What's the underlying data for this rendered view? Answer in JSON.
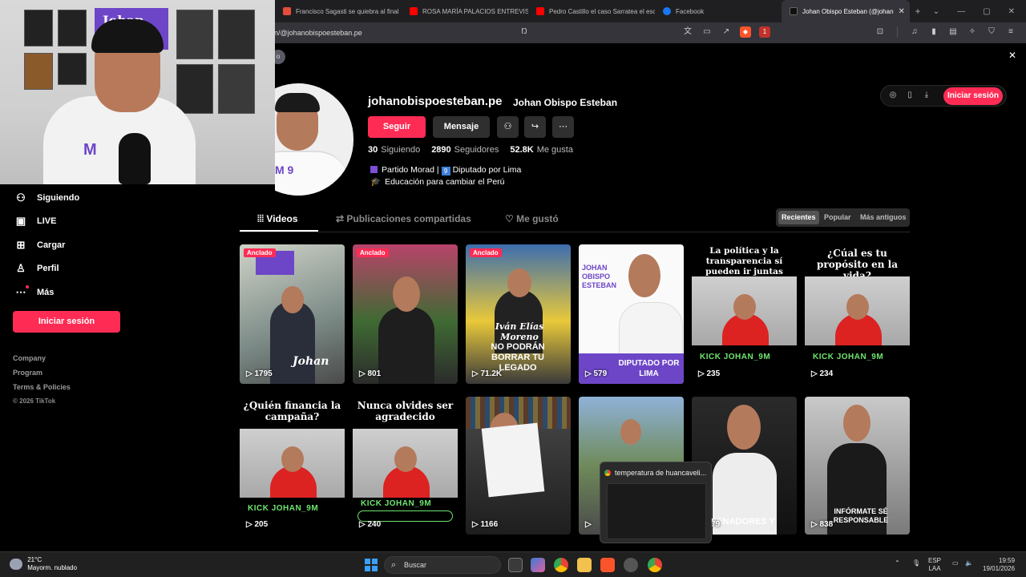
{
  "browser": {
    "tabs": [
      {
        "title": "Francisco Sagasti se quiebra al final",
        "color": "#e74c3c"
      },
      {
        "title": "ROSA MARÍA PALACIOS ENTREVISTA",
        "color": "#ff0000"
      },
      {
        "title": "Pedro Castillo el caso Sarratea el esc",
        "color": "#ff0000"
      },
      {
        "title": "Facebook",
        "color": "#1877f2"
      },
      {
        "title": "Johan Obispo Esteban (@johan",
        "color": "#111111"
      }
    ],
    "url": "n/@johanobispoesteban.pe",
    "brave_badge": "1"
  },
  "sidebar": {
    "items": [
      {
        "icon": "following-icon",
        "glyph": "⚇",
        "label": "Siguiendo"
      },
      {
        "icon": "live-icon",
        "glyph": "▣",
        "label": "LIVE"
      },
      {
        "icon": "upload-icon",
        "glyph": "⊞",
        "label": "Cargar"
      },
      {
        "icon": "profile-icon",
        "glyph": "♙",
        "label": "Perfil"
      },
      {
        "icon": "more-icon",
        "glyph": "⋯",
        "label": "Más"
      }
    ],
    "login_label": "Iniciar sesión",
    "footer": [
      "Company",
      "Program",
      "Terms & Policies",
      "© 2026 TikTok"
    ]
  },
  "profile": {
    "username": "johanobispoesteban.pe",
    "nickname": "Johan Obispo Esteban",
    "follow_label": "Seguir",
    "message_label": "Mensaje",
    "stats": {
      "following_count": "30",
      "following_label": "Siguiendo",
      "followers_count": "2890",
      "followers_label": "Seguidores",
      "likes_count": "52.8K",
      "likes_label": "Me gusta"
    },
    "bio_line1a": "Partido Morad |",
    "bio_line1b": "Diputado por Lima",
    "bio_line2": "Educación para cambiar el Perú",
    "bio_nine": "9"
  },
  "header": {
    "login_label": "Iniciar sesión"
  },
  "tabs": {
    "videos": "Videos",
    "shared": "Publicaciones compartidas",
    "liked": "Me gustó",
    "sort": [
      "Recientes",
      "Popular",
      "Más antiguos"
    ]
  },
  "videos": [
    {
      "views": "1795",
      "pinned": "Anclado",
      "caption": "Johan"
    },
    {
      "views": "801",
      "pinned": "Anclado"
    },
    {
      "views": "71.2K",
      "pinned": "Anclado",
      "caption": "NO PODRÁN BORRAR TU LEGADO",
      "overlay": "Iván Elías Moreno"
    },
    {
      "views": "579",
      "caption": "JOHAN OBISPO ESTEBAN",
      "badge": "DIPUTADO POR LIMA"
    },
    {
      "views": "235",
      "caption": "La política y la transparencia sí pueden ir juntas",
      "kick": "KICK   JOHAN_9M"
    },
    {
      "views": "234",
      "caption": "¿Cúal es tu propósito en la vida?",
      "kick": "KICK   JOHAN_9M"
    },
    {
      "views": "205",
      "caption": "¿Quién financia la campaña?",
      "kick": "KICK   JOHAN_9M"
    },
    {
      "views": "240",
      "caption": "Nunca olvides ser agradecido",
      "kick": "KICK   JOHAN_9M"
    },
    {
      "views": "1166"
    },
    {
      "views": ""
    },
    {
      "views": "379",
      "caption": "SENADORES Y"
    },
    {
      "views": "838",
      "caption": "INFÓRMATE SÉ RESPONSABLE"
    }
  ],
  "popup": {
    "title": "temperatura de huancaveli..."
  },
  "taskbar": {
    "temp": "21°C",
    "weather": "Mayorm. nublado",
    "search": "Buscar",
    "lang1": "ESP",
    "lang2": "LAA",
    "time": "19:59",
    "date": "19/01/2026"
  },
  "colors": {
    "accent": "#fe2c55",
    "purple": "#6d46c7"
  }
}
